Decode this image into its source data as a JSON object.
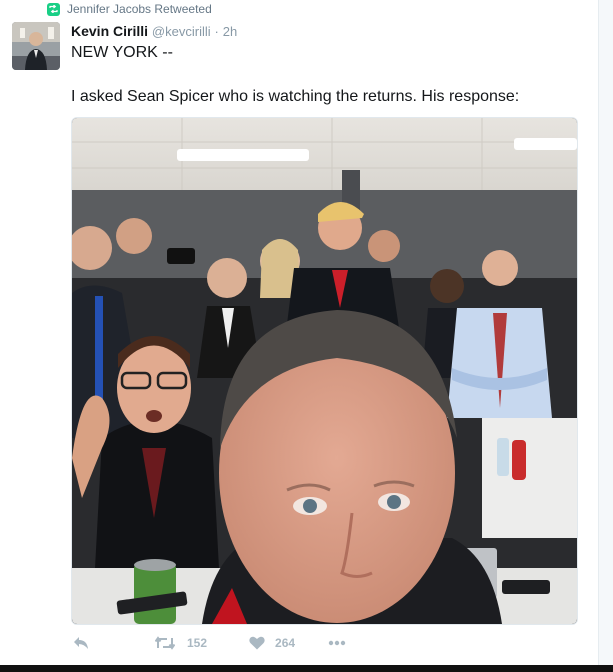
{
  "retweet_context": {
    "label": "Jennifer Jacobs Retweeted",
    "icon": "retweet-icon",
    "color": "#19cf86"
  },
  "tweet": {
    "author_name": "Kevin Cirilli",
    "handle": "@kevcirilli",
    "separator": "·",
    "time": "2h",
    "line1": "NEW YORK --",
    "line2": "I asked Sean Spicer who is watching the returns. His response:"
  },
  "actions": {
    "reply_icon": "reply-icon",
    "retweet_icon": "retweet-icon",
    "retweet_count": "152",
    "like_icon": "heart-icon",
    "like_count": "264",
    "more_icon": "more-icon"
  },
  "colors": {
    "action_gray": "#aab8c2",
    "meta_gray": "#8899a6"
  }
}
